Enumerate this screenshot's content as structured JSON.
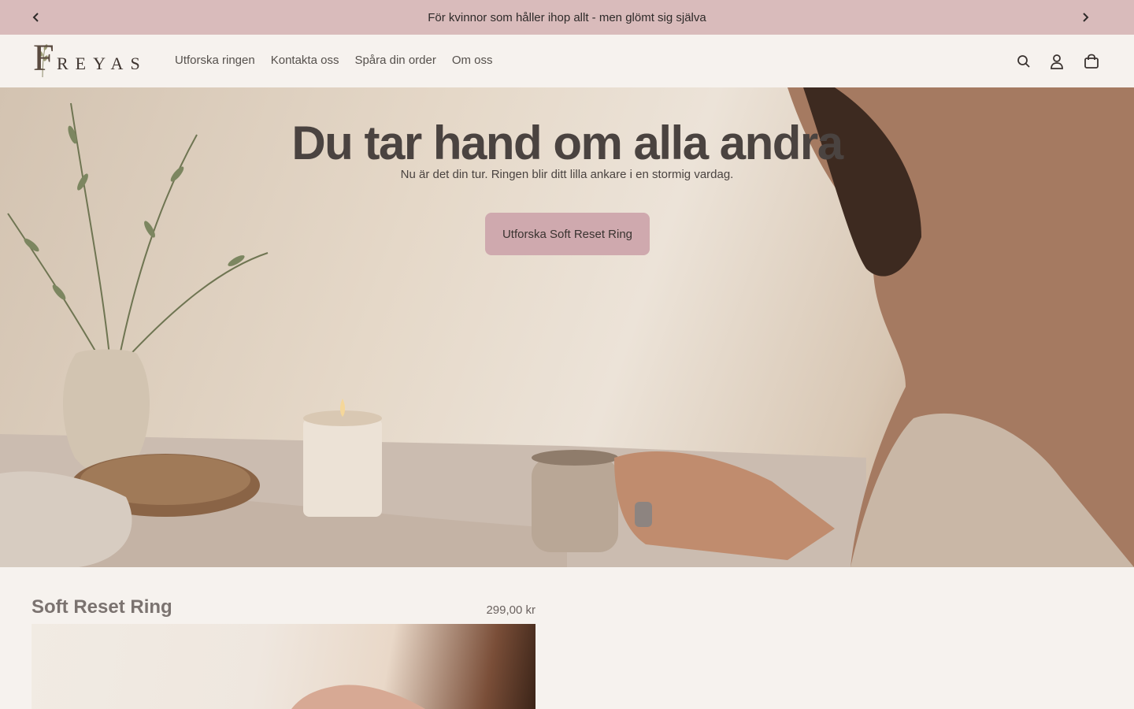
{
  "announcement": {
    "text": "För kvinnor som håller ihop allt - men glömt sig själva",
    "prev_icon": "chevron-left-icon",
    "next_icon": "chevron-right-icon"
  },
  "header": {
    "logo_text": "FREYAS",
    "logo_initial": "F",
    "logo_rest": "REYAS",
    "nav": [
      {
        "label": "Utforska ringen"
      },
      {
        "label": "Kontakta oss"
      },
      {
        "label": "Spåra din order"
      },
      {
        "label": "Om oss"
      }
    ],
    "icons": [
      "search-icon",
      "account-icon",
      "cart-icon"
    ]
  },
  "hero": {
    "title": "Du tar hand om alla andra",
    "subtitle": "Nu är det din tur. Ringen blir ditt lilla ankare i en stormig vardag.",
    "cta": "Utforska Soft Reset Ring"
  },
  "product": {
    "title": "Soft Reset Ring",
    "price": "299,00 kr"
  },
  "colors": {
    "announcement_bg": "#d9bbbb",
    "page_bg": "#f6f2ee",
    "cta_bg": "#cfa9ae",
    "text": "#3c3633"
  }
}
